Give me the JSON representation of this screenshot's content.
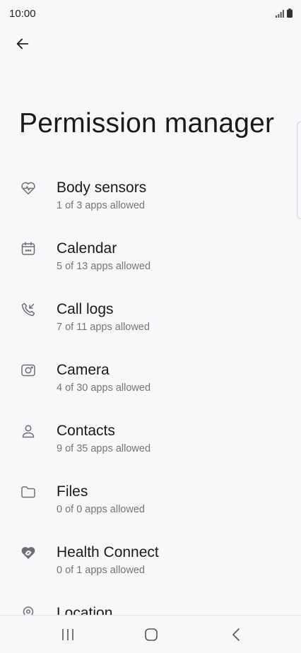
{
  "status_bar": {
    "time": "10:00"
  },
  "header": {
    "title": "Permission manager"
  },
  "permissions": [
    {
      "label": "Body sensors",
      "summary": "1 of 3 apps allowed",
      "icon": "heart-pulse-icon"
    },
    {
      "label": "Calendar",
      "summary": "5 of 13 apps allowed",
      "icon": "calendar-icon"
    },
    {
      "label": "Call logs",
      "summary": "7 of 11 apps allowed",
      "icon": "call-log-icon"
    },
    {
      "label": "Camera",
      "summary": "4 of 30 apps allowed",
      "icon": "camera-icon"
    },
    {
      "label": "Contacts",
      "summary": "9 of 35 apps allowed",
      "icon": "contacts-icon"
    },
    {
      "label": "Files",
      "summary": "0 of 0 apps allowed",
      "icon": "folder-icon"
    },
    {
      "label": "Health Connect",
      "summary": "0 of 1 apps allowed",
      "icon": "health-connect-icon"
    },
    {
      "label": "Location",
      "summary": "",
      "icon": "location-icon"
    }
  ],
  "colors": {
    "background": "#f8f8fa",
    "text_primary": "#1a1a1a",
    "text_secondary": "#767679",
    "icon": "#6f6f73"
  }
}
